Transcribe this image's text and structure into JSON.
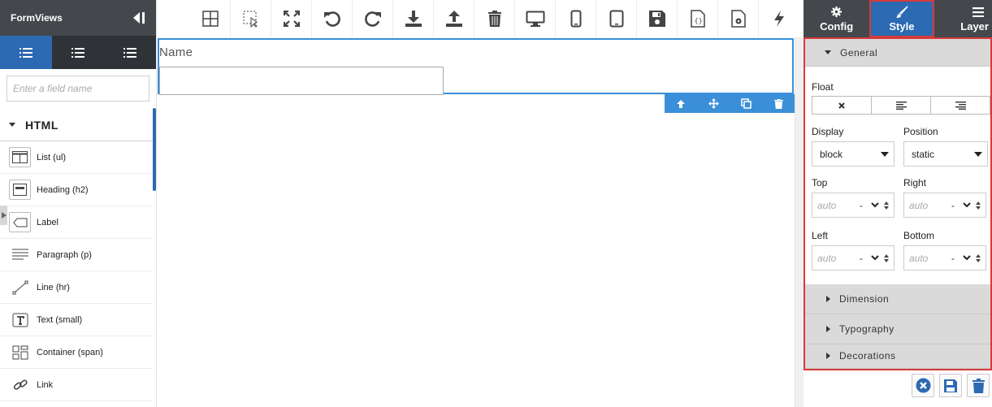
{
  "app": {
    "title": "FormViews"
  },
  "search": {
    "placeholder": "Enter a field name"
  },
  "palette": {
    "section_title": "HTML",
    "items": [
      {
        "label": "List (ul)",
        "icon": "list-layout-icon"
      },
      {
        "label": "Heading (h2)",
        "icon": "heading-icon"
      },
      {
        "label": "Label",
        "icon": "label-tag-icon"
      },
      {
        "label": "Paragraph (p)",
        "icon": "paragraph-icon"
      },
      {
        "label": "Line (hr)",
        "icon": "line-icon"
      },
      {
        "label": "Text (small)",
        "icon": "text-t-icon"
      },
      {
        "label": "Container (span)",
        "icon": "container-grid-icon"
      },
      {
        "label": "Link",
        "icon": "link-icon"
      }
    ]
  },
  "toolbar": {
    "icons": [
      "grid-icon",
      "select-region-icon",
      "fullscreen-icon",
      "undo-icon",
      "redo-icon",
      "import-icon",
      "export-icon",
      "trash-icon",
      "desktop-icon",
      "mobile-icon",
      "tablet-icon",
      "save-icon",
      "code-file-icon",
      "settings-file-icon",
      "lightning-icon"
    ]
  },
  "canvas": {
    "field_label": "Name",
    "field_value": ""
  },
  "right_tabs": [
    {
      "label": "Config",
      "icon": "gear-icon"
    },
    {
      "label": "Style",
      "icon": "paintbrush-icon",
      "active": true
    },
    {
      "label": "Layer",
      "icon": "hamburger-icon"
    }
  ],
  "style": {
    "general": {
      "title": "General",
      "float_label": "Float",
      "display_label": "Display",
      "display_value": "block",
      "position_label": "Position",
      "position_value": "static",
      "top_label": "Top",
      "right_label": "Right",
      "left_label": "Left",
      "bottom_label": "Bottom",
      "auto_placeholder": "auto",
      "unit_placeholder": "-"
    },
    "sections": [
      "Dimension",
      "Typography",
      "Decorations"
    ]
  },
  "colors": {
    "accent": "#2c6ab3",
    "selection": "#3b8fd9",
    "highlight": "#d83a3a",
    "dark": "#44474c"
  }
}
